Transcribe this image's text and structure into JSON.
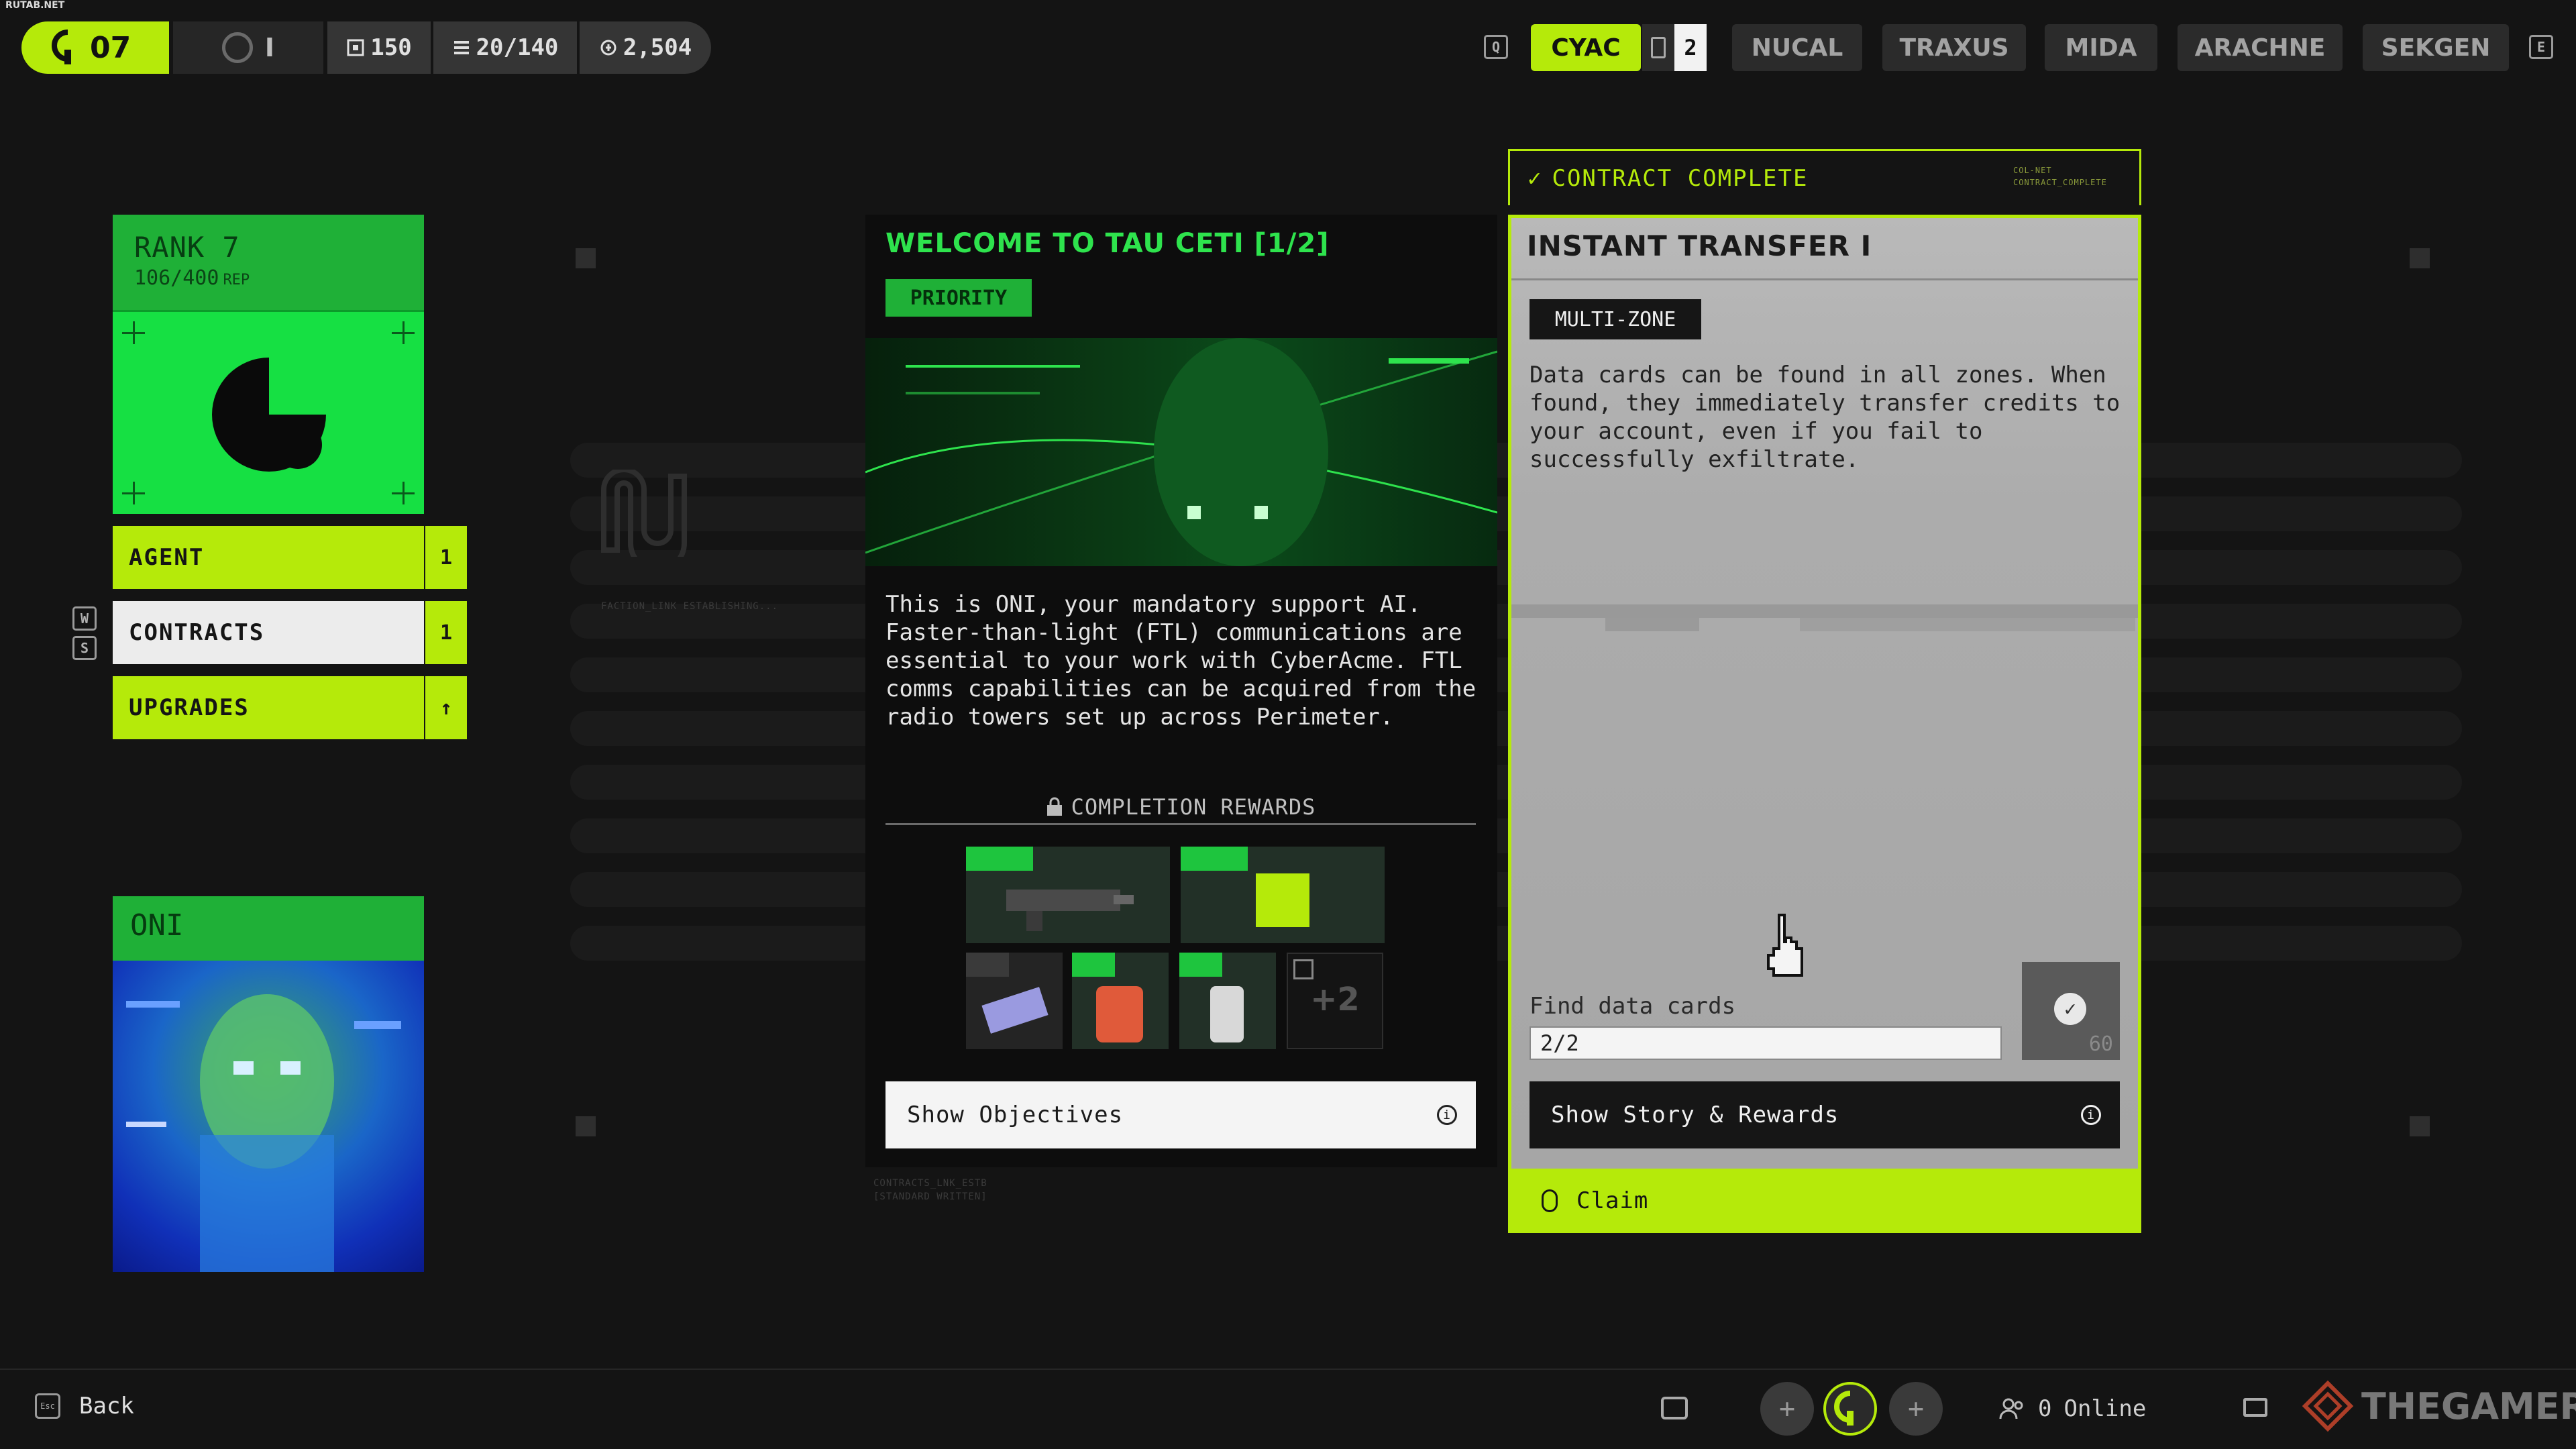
{
  "corner_mark": "RUTAB.NET",
  "top_bar": {
    "level": "07",
    "tier": "I",
    "stat_1": "150",
    "stat_2": "20/140",
    "stat_3": "2,504",
    "key_left": "Q",
    "key_right": "E",
    "factions": [
      {
        "label": "CYAC",
        "active": true
      },
      {
        "label": "NUCAL"
      },
      {
        "label": "TRAXUS"
      },
      {
        "label": "MIDA"
      },
      {
        "label": "ARACHNE"
      },
      {
        "label": "SEKGEN"
      }
    ],
    "cyac_count": "2"
  },
  "rank_card": {
    "title": "RANK 7",
    "rep": "106/400",
    "rep_unit": "REP"
  },
  "menu": {
    "agent": {
      "label": "AGENT",
      "badge": "1"
    },
    "contracts": {
      "label": "CONTRACTS",
      "badge": "1"
    },
    "upgrades": {
      "label": "UPGRADES",
      "badge": "↑"
    },
    "key_up": "W",
    "key_down": "S"
  },
  "oni": {
    "title": "ONI"
  },
  "faint": {
    "faction_link": "FACTION_LINK ESTABLISHING...",
    "contract_link": "CONTRACTS_LNK_ESTB",
    "contract_link_2": "[STANDARD WRITTEN]",
    "col_net": "COL-NET",
    "col_net_2": "CONTRACT_COMPLETE"
  },
  "mission": {
    "title": "WELCOME TO TAU CETI [1/2]",
    "tag": "PRIORITY",
    "description": "This is ONI, your mandatory support AI. Faster-than-light (FTL) communications are essential to your work with CyberAcme. FTL comms capabilities can be acquired from the radio towers set up across Perimeter.",
    "rewards_label": "COMPLETION REWARDS",
    "extra_rewards": "+2",
    "objectives_button": "Show Objectives"
  },
  "contract": {
    "status": "CONTRACT COMPLETE",
    "title": "INSTANT TRANSFER I",
    "tag": "MULTI-ZONE",
    "description": "Data cards can be found in all zones. When found, they immediately transfer credits to your account, even if you fail to successfully exfiltrate.",
    "objective_label": "Find data cards",
    "objective_progress": "2/2",
    "objective_reward": "60",
    "story_button": "Show Story & Rewards",
    "claim_label": "Claim"
  },
  "bottom_bar": {
    "back_key": "Esc",
    "back_label": "Back",
    "online_count": "0",
    "online_label": "Online",
    "watermark": "THEGAMER"
  },
  "colors": {
    "accent_lime": "#b5ea0a",
    "faction_green": "#1fb037",
    "bright_green": "#16e043",
    "background": "#141414"
  }
}
